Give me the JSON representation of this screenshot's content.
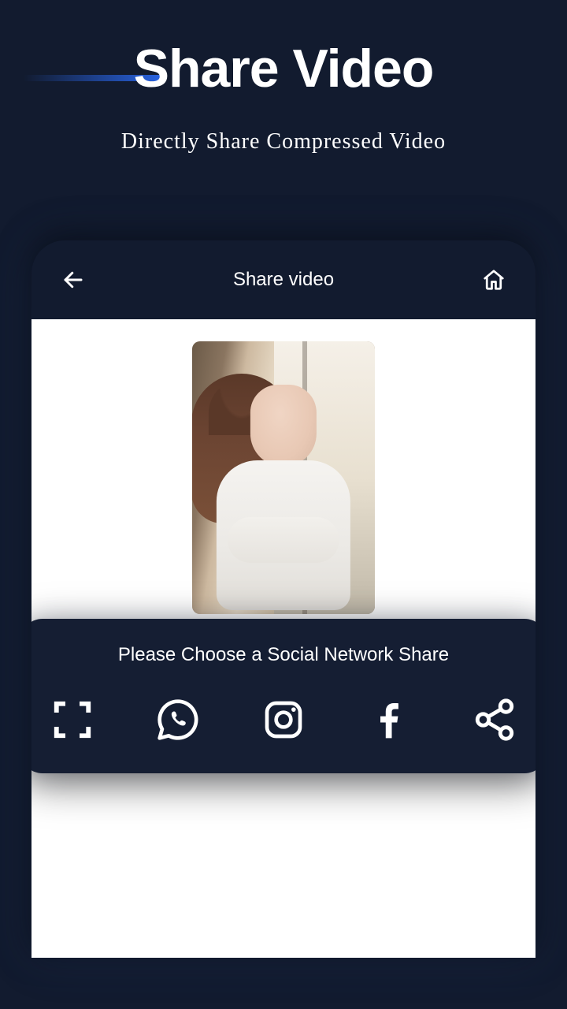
{
  "hero": {
    "title": "Share Video",
    "subtitle": "Directly Share Compressed Video"
  },
  "app": {
    "header_title": "Share video"
  },
  "share_panel": {
    "title": "Please Choose a Social Network Share",
    "options": [
      {
        "name": "fullscreen"
      },
      {
        "name": "whatsapp"
      },
      {
        "name": "instagram"
      },
      {
        "name": "facebook"
      },
      {
        "name": "share"
      }
    ]
  }
}
